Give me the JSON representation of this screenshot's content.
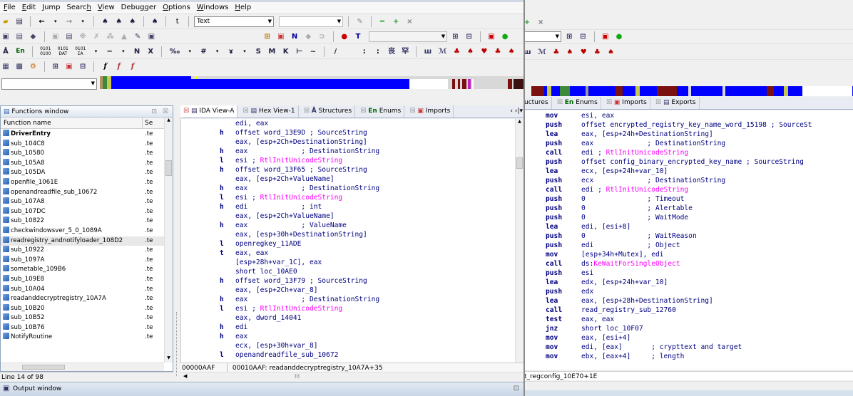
{
  "menu": [
    {
      "label": "File",
      "u": 0
    },
    {
      "label": "Edit",
      "u": 0
    },
    {
      "label": "Jump",
      "u": 0
    },
    {
      "label": "Search",
      "u": 5
    },
    {
      "label": "View",
      "u": 0
    },
    {
      "label": "Debugger",
      "u": 4
    },
    {
      "label": "Options",
      "u": 0
    },
    {
      "label": "Windows",
      "u": 0
    },
    {
      "label": "Help",
      "u": 0
    }
  ],
  "toolbar": {
    "text_combo": "Text",
    "row4_glyphs": [
      "f",
      "f",
      "f"
    ]
  },
  "functions": {
    "title": "Functions window",
    "col_name": "Function name",
    "col_seg": "Se",
    "rows": [
      {
        "name": "DriverEntry",
        "seg": ".te",
        "bold": true
      },
      {
        "name": "sub_104C8",
        "seg": ".te"
      },
      {
        "name": "sub_10580",
        "seg": ".te"
      },
      {
        "name": "sub_105A8",
        "seg": ".te"
      },
      {
        "name": "sub_105DA",
        "seg": ".te"
      },
      {
        "name": "openfile_1061E",
        "seg": ".te"
      },
      {
        "name": "openandreadfile_sub_10672",
        "seg": ".te"
      },
      {
        "name": "sub_107A8",
        "seg": ".te"
      },
      {
        "name": "sub_107DC",
        "seg": ".te"
      },
      {
        "name": "sub_10822",
        "seg": ".te"
      },
      {
        "name": "checkwindowsver_5_0_1089A",
        "seg": ".te"
      },
      {
        "name": "readregistry_andnotifyloader_108D2",
        "seg": ".te",
        "selected": true
      },
      {
        "name": "sub_10922",
        "seg": ".te"
      },
      {
        "name": "sub_1097A",
        "seg": ".te"
      },
      {
        "name": "sometable_109B6",
        "seg": ".te"
      },
      {
        "name": "sub_109E8",
        "seg": ".te"
      },
      {
        "name": "sub_10A04",
        "seg": ".te"
      },
      {
        "name": "readanddecryptregistry_10A7A",
        "seg": ".te"
      },
      {
        "name": "sub_10B20",
        "seg": ".te"
      },
      {
        "name": "sub_10B52",
        "seg": ".te"
      },
      {
        "name": "sub_10B76",
        "seg": ".te"
      },
      {
        "name": "NotifyRoutine",
        "seg": ".te"
      }
    ],
    "line_status": "Line 14 of 98"
  },
  "output_window": "Output window",
  "front_tabs": [
    "IDA View-A",
    "Hex View-1",
    "Structures",
    "Enums",
    "Imports"
  ],
  "back_tabs": [
    "uctures",
    "Enums",
    "Imports",
    "Exports"
  ],
  "code_front": [
    {
      "m": "",
      "mn": "",
      "op": "edi, eax",
      "cm": ""
    },
    {
      "m": "h",
      "mn": "",
      "op": "offset word_13E9D ; SourceString",
      "cm": ""
    },
    {
      "m": "",
      "mn": "",
      "op": "eax, [esp+2Ch+DestinationString]",
      "cm": ""
    },
    {
      "m": "h",
      "mn": "",
      "op": "eax             ; DestinationString",
      "cm": ""
    },
    {
      "m": "l",
      "mn": "",
      "op": "esi ; ",
      "fn": "RtlInitUnicodeString"
    },
    {
      "m": "h",
      "mn": "",
      "op": "offset word_13F65 ; SourceString",
      "cm": ""
    },
    {
      "m": "",
      "mn": "",
      "op": "eax, [esp+2Ch+ValueName]",
      "cm": ""
    },
    {
      "m": "h",
      "mn": "",
      "op": "eax             ; DestinationString",
      "cm": ""
    },
    {
      "m": "l",
      "mn": "",
      "op": "esi ; ",
      "fn": "RtlInitUnicodeString"
    },
    {
      "m": "h",
      "mn": "",
      "op": "edi             ; int",
      "cm": ""
    },
    {
      "m": "",
      "mn": "",
      "op": "eax, [esp+2Ch+ValueName]",
      "cm": ""
    },
    {
      "m": "h",
      "mn": "",
      "op": "eax             ; ValueName",
      "cm": ""
    },
    {
      "m": "",
      "mn": "",
      "op": "eax, [esp+30h+DestinationString]",
      "cm": ""
    },
    {
      "m": "l",
      "mn": "",
      "op": "openregkey_11ADE",
      "cm": ""
    },
    {
      "m": "t",
      "mn": "",
      "op": "eax, eax",
      "cm": ""
    },
    {
      "m": "",
      "mn": "",
      "op": "[esp+28h+var_1C], eax",
      "cm": ""
    },
    {
      "m": "",
      "mn": "",
      "op": "short loc_10AE0",
      "cm": ""
    },
    {
      "m": "h",
      "mn": "",
      "op": "offset word_13F79 ; SourceString",
      "cm": ""
    },
    {
      "m": "",
      "mn": "",
      "op": "eax, [esp+2Ch+var_8]",
      "cm": ""
    },
    {
      "m": "h",
      "mn": "",
      "op": "eax             ; DestinationString",
      "cm": ""
    },
    {
      "m": "l",
      "mn": "",
      "op": "esi ; ",
      "fn": "RtlInitUnicodeString"
    },
    {
      "m": "",
      "mn": "",
      "op": "eax, dword_14041",
      "cm": ""
    },
    {
      "m": "h",
      "mn": "",
      "op": "edi",
      "cm": ""
    },
    {
      "m": "h",
      "mn": "",
      "op": "eax",
      "cm": ""
    },
    {
      "m": "",
      "mn": "",
      "op": "ecx, [esp+30h+var_8]",
      "cm": ""
    },
    {
      "m": "l",
      "mn": "",
      "op": "openandreadfile_sub_10672",
      "cm": ""
    }
  ],
  "front_status": {
    "addr": "00000AAF",
    "loc": "00010AAF: readanddecryptregistry_10A7A+35"
  },
  "code_back": [
    {
      "mn": "mov",
      "op": "esi, eax"
    },
    {
      "mn": "push",
      "op": "offset encrypted_registry_key_name_word_15198 ; SourceSt"
    },
    {
      "mn": "lea",
      "op": "eax, [esp+24h+DestinationString]"
    },
    {
      "mn": "push",
      "op": "eax             ; DestinationString"
    },
    {
      "mn": "call",
      "op": "edi ; ",
      "fn": "RtlInitUnicodeString"
    },
    {
      "mn": "push",
      "op": "offset config_binary_encrypted_key_name ; SourceString"
    },
    {
      "mn": "lea",
      "op": "ecx, [esp+24h+var_10]"
    },
    {
      "mn": "push",
      "op": "ecx             ; DestinationString"
    },
    {
      "mn": "call",
      "op": "edi ; ",
      "fn": "RtlInitUnicodeString"
    },
    {
      "mn": "push",
      "op": "0               ; Timeout"
    },
    {
      "mn": "push",
      "op": "0               ; Alertable"
    },
    {
      "mn": "push",
      "op": "0               ; WaitMode"
    },
    {
      "mn": "lea",
      "op": "edi, [esi+8]"
    },
    {
      "mn": "push",
      "op": "0               ; WaitReason"
    },
    {
      "mn": "push",
      "op": "edi             ; Object"
    },
    {
      "mn": "mov",
      "op": "[esp+34h+Mutex], edi"
    },
    {
      "mn": "call",
      "op": "ds:",
      "fn": "KeWaitForSingleObject"
    },
    {
      "mn": "push",
      "op": "esi"
    },
    {
      "mn": "lea",
      "op": "edx, [esp+24h+var_10]"
    },
    {
      "mn": "push",
      "op": "edx"
    },
    {
      "mn": "lea",
      "op": "eax, [esp+28h+DestinationString]"
    },
    {
      "mn": "call",
      "op": "read_registry_sub_12760"
    },
    {
      "mn": "test",
      "op": "eax, eax"
    },
    {
      "mn": "jnz",
      "op": "short loc_10F07"
    },
    {
      "mn": "mov",
      "op": "eax, [esi+4]"
    },
    {
      "mn": "mov",
      "op": "edi, [eax]       ; crypttext and target"
    },
    {
      "mn": "mov",
      "op": "ebx, [eax+4]     ; length"
    }
  ],
  "back_status": "t_regconfig_10E70+1E",
  "colors": {
    "navy": "#000080",
    "blue": "#0000ff",
    "magenta": "#ff00ff",
    "navbar_blue": "#0000ff"
  }
}
